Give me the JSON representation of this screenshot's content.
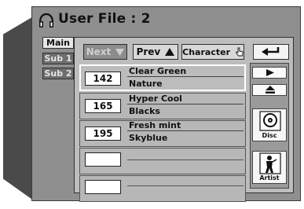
{
  "header": {
    "title": "User File : 2",
    "icon": "headphones-icon"
  },
  "tabs": [
    {
      "label": "Main",
      "selected": true
    },
    {
      "label": "Sub 1",
      "selected": false
    },
    {
      "label": "Sub 2",
      "selected": false
    }
  ],
  "toolbar": {
    "next_label": "Next",
    "prev_label": "Prev",
    "character_label": "Character",
    "next_icon": "down-triangle-icon",
    "prev_icon": "up-triangle-icon",
    "character_icon": "hand-pointer-icon",
    "back_icon": "return-arrow-icon"
  },
  "rows": [
    {
      "number": "142",
      "line1": "Clear Green",
      "line2": "Nature",
      "selected": true
    },
    {
      "number": "165",
      "line1": "Hyper Cool",
      "line2": "Blacks",
      "selected": false
    },
    {
      "number": "195",
      "line1": "Fresh mint",
      "line2": "Skyblue",
      "selected": false
    },
    {
      "number": "",
      "line1": "",
      "line2": "",
      "selected": false
    },
    {
      "number": "",
      "line1": "",
      "line2": "",
      "selected": false
    }
  ],
  "side_controls": {
    "play_icon": "play-icon",
    "eject_icon": "eject-icon",
    "disc_label": "Disc",
    "disc_icon": "disc-icon",
    "artist_label": "Artist",
    "artist_icon": "artist-icon"
  }
}
